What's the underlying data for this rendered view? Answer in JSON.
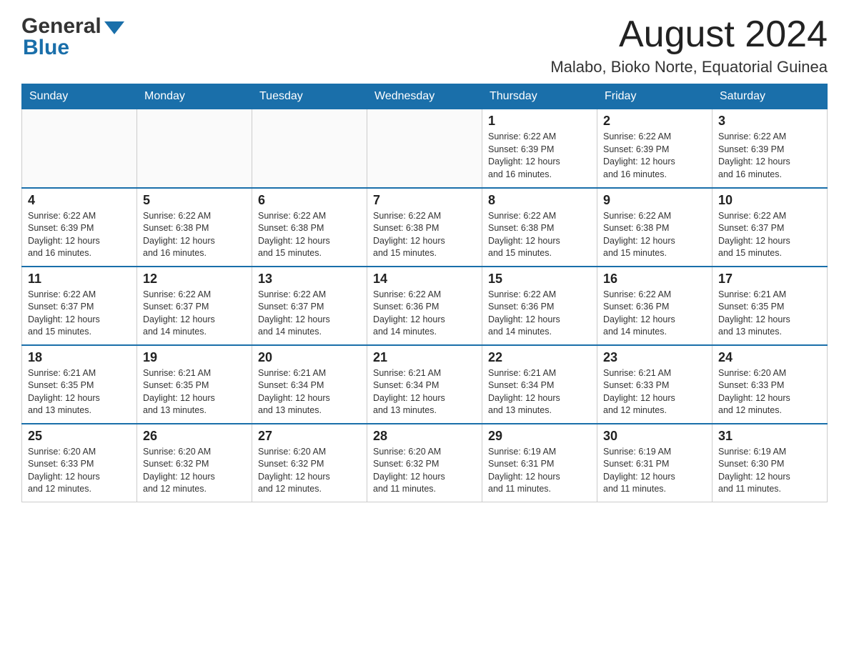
{
  "header": {
    "month_title": "August 2024",
    "location": "Malabo, Bioko Norte, Equatorial Guinea"
  },
  "days_of_week": [
    "Sunday",
    "Monday",
    "Tuesday",
    "Wednesday",
    "Thursday",
    "Friday",
    "Saturday"
  ],
  "weeks": [
    {
      "days": [
        {
          "number": "",
          "info": ""
        },
        {
          "number": "",
          "info": ""
        },
        {
          "number": "",
          "info": ""
        },
        {
          "number": "",
          "info": ""
        },
        {
          "number": "1",
          "info": "Sunrise: 6:22 AM\nSunset: 6:39 PM\nDaylight: 12 hours\nand 16 minutes."
        },
        {
          "number": "2",
          "info": "Sunrise: 6:22 AM\nSunset: 6:39 PM\nDaylight: 12 hours\nand 16 minutes."
        },
        {
          "number": "3",
          "info": "Sunrise: 6:22 AM\nSunset: 6:39 PM\nDaylight: 12 hours\nand 16 minutes."
        }
      ]
    },
    {
      "days": [
        {
          "number": "4",
          "info": "Sunrise: 6:22 AM\nSunset: 6:39 PM\nDaylight: 12 hours\nand 16 minutes."
        },
        {
          "number": "5",
          "info": "Sunrise: 6:22 AM\nSunset: 6:38 PM\nDaylight: 12 hours\nand 16 minutes."
        },
        {
          "number": "6",
          "info": "Sunrise: 6:22 AM\nSunset: 6:38 PM\nDaylight: 12 hours\nand 15 minutes."
        },
        {
          "number": "7",
          "info": "Sunrise: 6:22 AM\nSunset: 6:38 PM\nDaylight: 12 hours\nand 15 minutes."
        },
        {
          "number": "8",
          "info": "Sunrise: 6:22 AM\nSunset: 6:38 PM\nDaylight: 12 hours\nand 15 minutes."
        },
        {
          "number": "9",
          "info": "Sunrise: 6:22 AM\nSunset: 6:38 PM\nDaylight: 12 hours\nand 15 minutes."
        },
        {
          "number": "10",
          "info": "Sunrise: 6:22 AM\nSunset: 6:37 PM\nDaylight: 12 hours\nand 15 minutes."
        }
      ]
    },
    {
      "days": [
        {
          "number": "11",
          "info": "Sunrise: 6:22 AM\nSunset: 6:37 PM\nDaylight: 12 hours\nand 15 minutes."
        },
        {
          "number": "12",
          "info": "Sunrise: 6:22 AM\nSunset: 6:37 PM\nDaylight: 12 hours\nand 14 minutes."
        },
        {
          "number": "13",
          "info": "Sunrise: 6:22 AM\nSunset: 6:37 PM\nDaylight: 12 hours\nand 14 minutes."
        },
        {
          "number": "14",
          "info": "Sunrise: 6:22 AM\nSunset: 6:36 PM\nDaylight: 12 hours\nand 14 minutes."
        },
        {
          "number": "15",
          "info": "Sunrise: 6:22 AM\nSunset: 6:36 PM\nDaylight: 12 hours\nand 14 minutes."
        },
        {
          "number": "16",
          "info": "Sunrise: 6:22 AM\nSunset: 6:36 PM\nDaylight: 12 hours\nand 14 minutes."
        },
        {
          "number": "17",
          "info": "Sunrise: 6:21 AM\nSunset: 6:35 PM\nDaylight: 12 hours\nand 13 minutes."
        }
      ]
    },
    {
      "days": [
        {
          "number": "18",
          "info": "Sunrise: 6:21 AM\nSunset: 6:35 PM\nDaylight: 12 hours\nand 13 minutes."
        },
        {
          "number": "19",
          "info": "Sunrise: 6:21 AM\nSunset: 6:35 PM\nDaylight: 12 hours\nand 13 minutes."
        },
        {
          "number": "20",
          "info": "Sunrise: 6:21 AM\nSunset: 6:34 PM\nDaylight: 12 hours\nand 13 minutes."
        },
        {
          "number": "21",
          "info": "Sunrise: 6:21 AM\nSunset: 6:34 PM\nDaylight: 12 hours\nand 13 minutes."
        },
        {
          "number": "22",
          "info": "Sunrise: 6:21 AM\nSunset: 6:34 PM\nDaylight: 12 hours\nand 13 minutes."
        },
        {
          "number": "23",
          "info": "Sunrise: 6:21 AM\nSunset: 6:33 PM\nDaylight: 12 hours\nand 12 minutes."
        },
        {
          "number": "24",
          "info": "Sunrise: 6:20 AM\nSunset: 6:33 PM\nDaylight: 12 hours\nand 12 minutes."
        }
      ]
    },
    {
      "days": [
        {
          "number": "25",
          "info": "Sunrise: 6:20 AM\nSunset: 6:33 PM\nDaylight: 12 hours\nand 12 minutes."
        },
        {
          "number": "26",
          "info": "Sunrise: 6:20 AM\nSunset: 6:32 PM\nDaylight: 12 hours\nand 12 minutes."
        },
        {
          "number": "27",
          "info": "Sunrise: 6:20 AM\nSunset: 6:32 PM\nDaylight: 12 hours\nand 12 minutes."
        },
        {
          "number": "28",
          "info": "Sunrise: 6:20 AM\nSunset: 6:32 PM\nDaylight: 12 hours\nand 11 minutes."
        },
        {
          "number": "29",
          "info": "Sunrise: 6:19 AM\nSunset: 6:31 PM\nDaylight: 12 hours\nand 11 minutes."
        },
        {
          "number": "30",
          "info": "Sunrise: 6:19 AM\nSunset: 6:31 PM\nDaylight: 12 hours\nand 11 minutes."
        },
        {
          "number": "31",
          "info": "Sunrise: 6:19 AM\nSunset: 6:30 PM\nDaylight: 12 hours\nand 11 minutes."
        }
      ]
    }
  ]
}
